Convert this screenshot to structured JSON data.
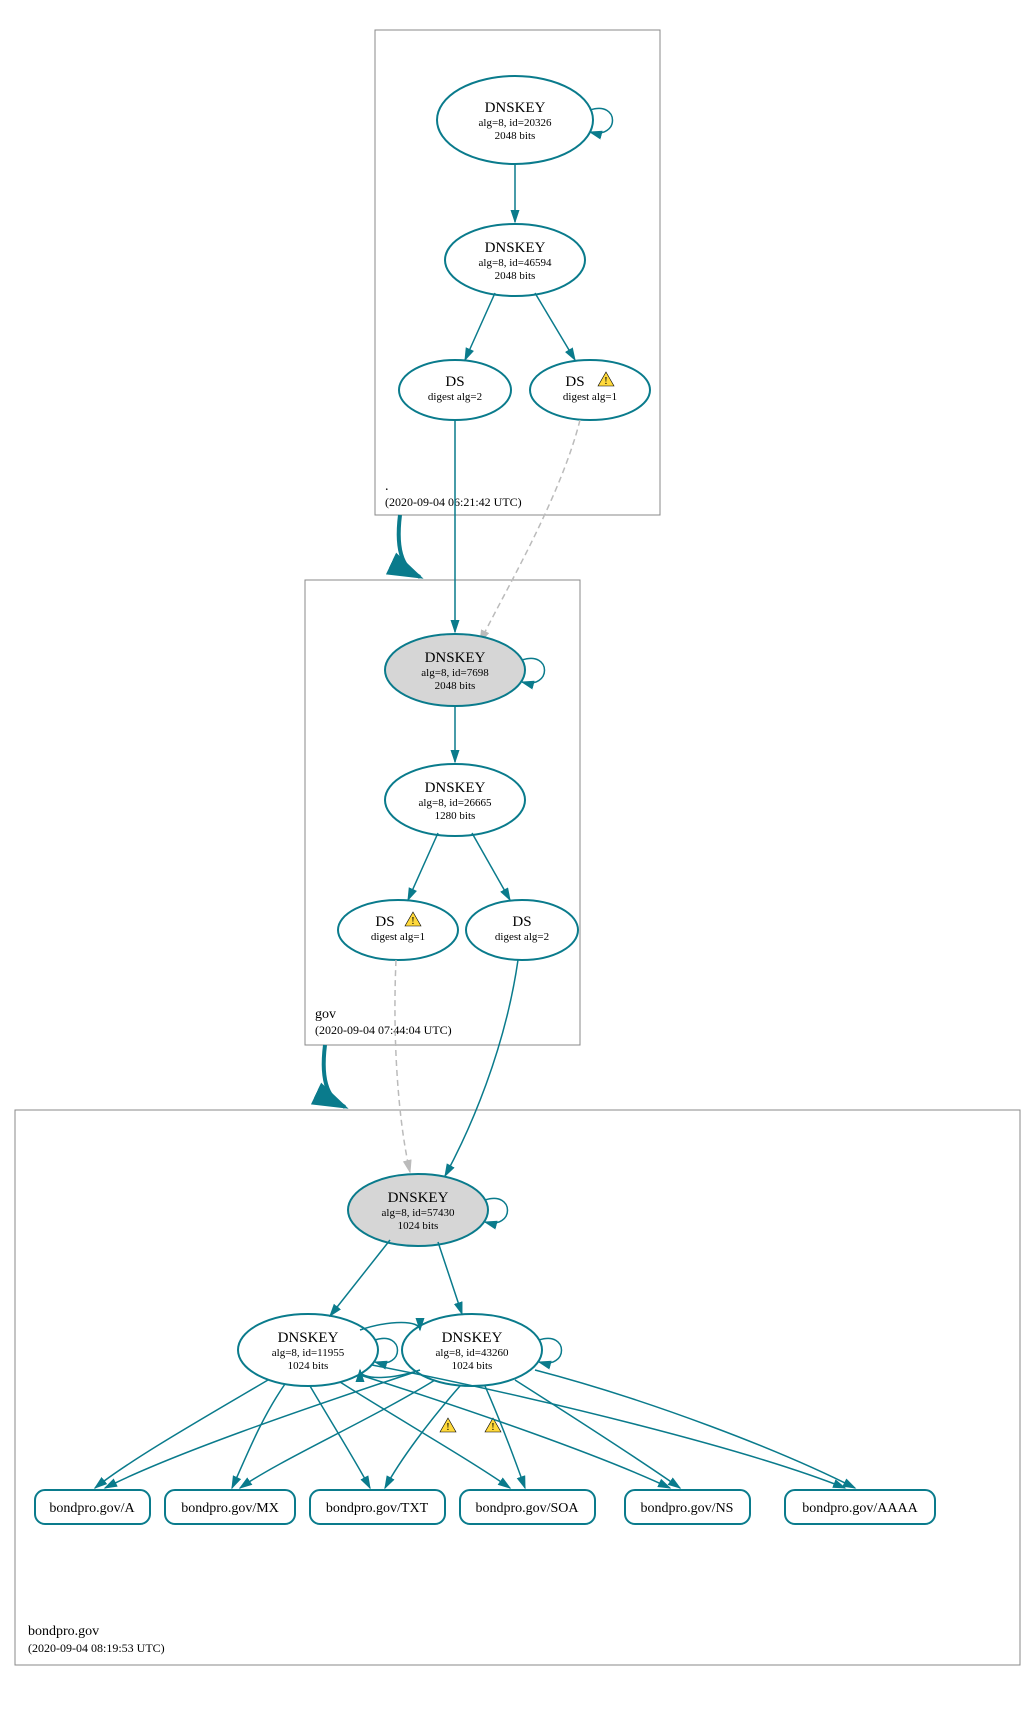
{
  "zones": [
    {
      "name": ".",
      "timestamp": "(2020-09-04 06:21:42 UTC)"
    },
    {
      "name": "gov",
      "timestamp": "(2020-09-04 07:44:04 UTC)"
    },
    {
      "name": "bondpro.gov",
      "timestamp": "(2020-09-04 08:19:53 UTC)"
    }
  ],
  "nodes": {
    "root_ksk": {
      "title": "DNSKEY",
      "line1": "alg=8, id=20326",
      "line2": "2048 bits"
    },
    "root_zsk": {
      "title": "DNSKEY",
      "line1": "alg=8, id=46594",
      "line2": "2048 bits"
    },
    "root_ds2": {
      "title": "DS",
      "line1": "digest alg=2"
    },
    "root_ds1": {
      "title": "DS",
      "line1": "digest alg=1"
    },
    "gov_ksk": {
      "title": "DNSKEY",
      "line1": "alg=8, id=7698",
      "line2": "2048 bits"
    },
    "gov_zsk": {
      "title": "DNSKEY",
      "line1": "alg=8, id=26665",
      "line2": "1280 bits"
    },
    "gov_ds1": {
      "title": "DS",
      "line1": "digest alg=1"
    },
    "gov_ds2": {
      "title": "DS",
      "line1": "digest alg=2"
    },
    "bp_ksk": {
      "title": "DNSKEY",
      "line1": "alg=8, id=57430",
      "line2": "1024 bits"
    },
    "bp_zsk1": {
      "title": "DNSKEY",
      "line1": "alg=8, id=11955",
      "line2": "1024 bits"
    },
    "bp_zsk2": {
      "title": "DNSKEY",
      "line1": "alg=8, id=43260",
      "line2": "1024 bits"
    }
  },
  "rrsets": {
    "a": "bondpro.gov/A",
    "mx": "bondpro.gov/MX",
    "txt": "bondpro.gov/TXT",
    "soa": "bondpro.gov/SOA",
    "ns": "bondpro.gov/NS",
    "aaaa": "bondpro.gov/AAAA"
  }
}
